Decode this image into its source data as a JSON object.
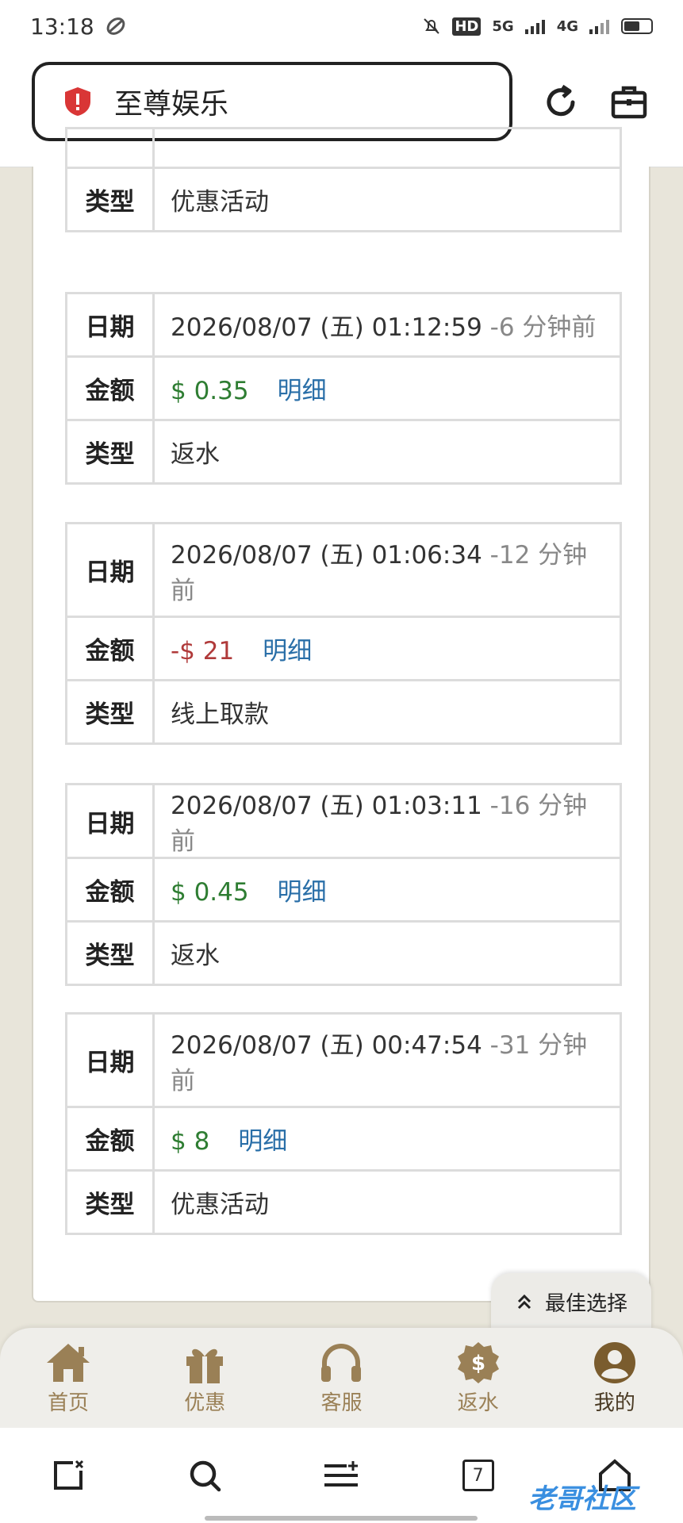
{
  "status_bar": {
    "time": "13:18",
    "network_hd": "HD",
    "network_5g": "5G",
    "network_4g": "4G",
    "battery_level": 0.6
  },
  "browser": {
    "site_title": "至尊娱乐"
  },
  "top_partial": {
    "label": "类型",
    "value": "优惠活动"
  },
  "records": [
    {
      "date_label": "日期",
      "date": "2026/08/07 (五) 01:12:59",
      "ago": "-6 分钟前",
      "amount_label": "金额",
      "amount": "$ 0.35",
      "amount_sign": "positive",
      "detail": "明细",
      "type_label": "类型",
      "type": "返水"
    },
    {
      "date_label": "日期",
      "date": "2026/08/07 (五) 01:06:34",
      "ago": "-12 分钟前",
      "amount_label": "金额",
      "amount": "-$ 21",
      "amount_sign": "negative",
      "detail": "明细",
      "type_label": "类型",
      "type": "线上取款"
    },
    {
      "date_label": "日期",
      "date": "2026/08/07 (五) 01:03:11",
      "ago": "-16 分钟前",
      "amount_label": "金额",
      "amount": "$ 0.45",
      "amount_sign": "positive",
      "detail": "明细",
      "type_label": "类型",
      "type": "返水"
    },
    {
      "date_label": "日期",
      "date": "2026/08/07 (五) 00:47:54",
      "ago": "-31 分钟前",
      "amount_label": "金额",
      "amount": "$ 8",
      "amount_sign": "positive",
      "detail": "明细",
      "type_label": "类型",
      "type": "优惠活动"
    }
  ],
  "best_choice": {
    "label": "最佳选择"
  },
  "bottom_nav": [
    {
      "label": "首页",
      "icon": "home-icon"
    },
    {
      "label": "优惠",
      "icon": "gift-icon"
    },
    {
      "label": "客服",
      "icon": "headset-icon"
    },
    {
      "label": "返水",
      "icon": "dollar-badge-icon"
    },
    {
      "label": "我的",
      "icon": "user-icon"
    }
  ],
  "toolbar": {
    "tab_count": "7"
  },
  "watermark": {
    "text": "老哥社区"
  },
  "colors": {
    "positive": "#2e7d32",
    "negative": "#b03a3a",
    "link": "#2a6fa8",
    "nav": "#9a8056"
  }
}
